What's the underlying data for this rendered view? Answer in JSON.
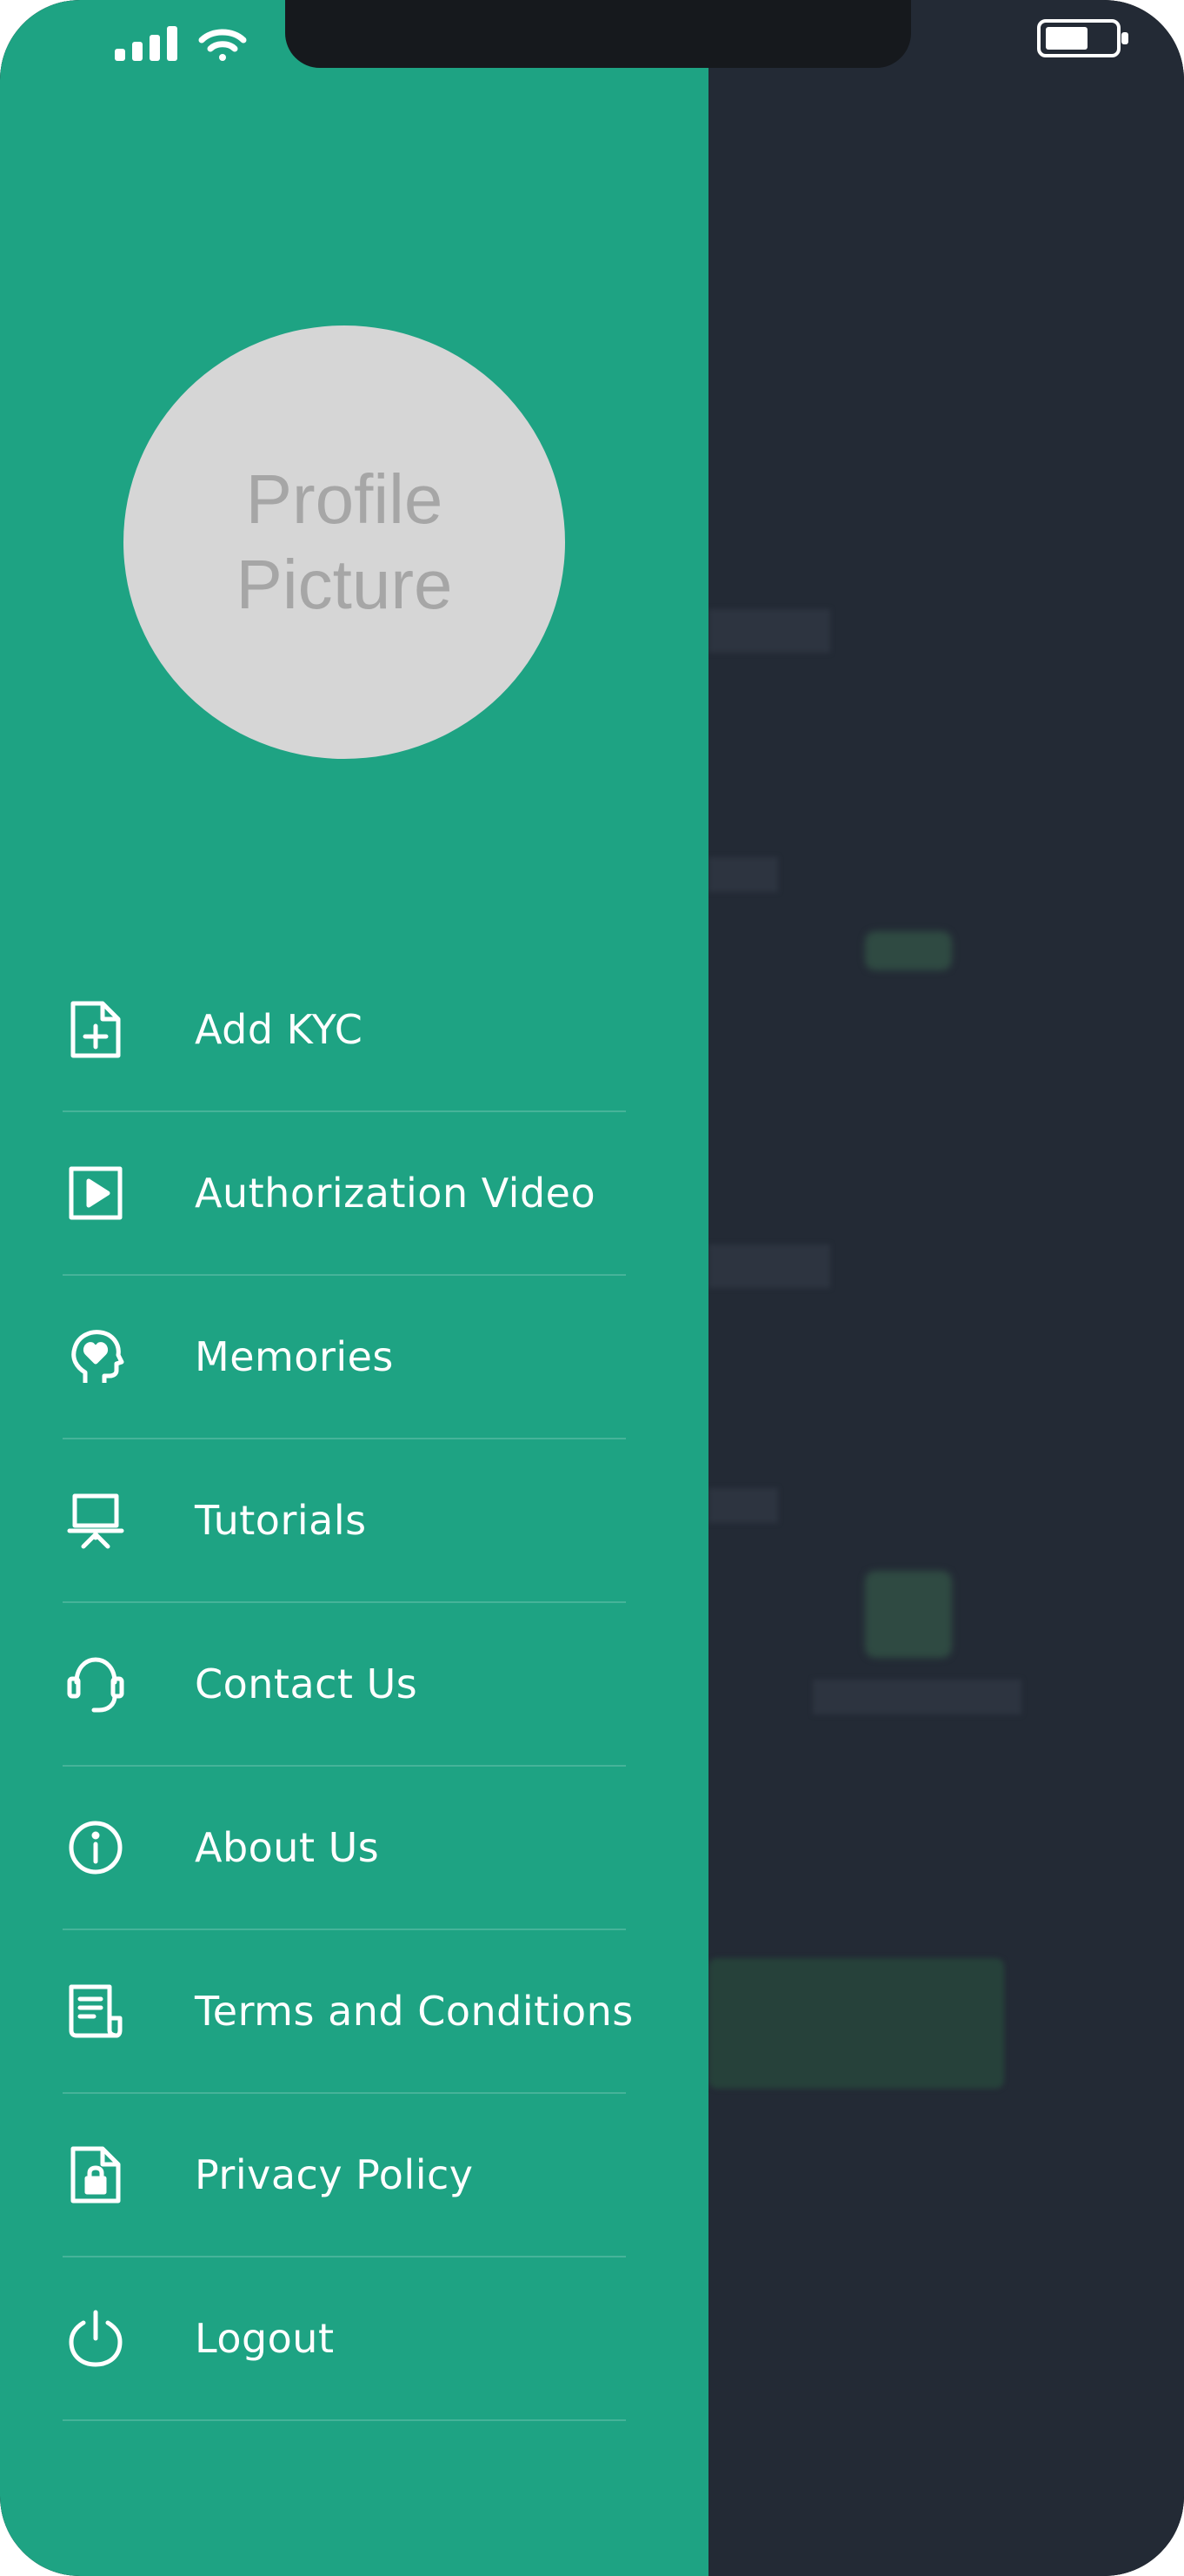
{
  "profile": {
    "placeholder": "Profile\nPicture"
  },
  "menu": [
    {
      "label": "Add KYC",
      "icon": "add-document-icon"
    },
    {
      "label": "Authorization Video",
      "icon": "play-video-icon"
    },
    {
      "label": "Memories",
      "icon": "head-heart-icon"
    },
    {
      "label": "Tutorials",
      "icon": "presentation-board-icon"
    },
    {
      "label": "Contact Us",
      "icon": "headset-icon"
    },
    {
      "label": "About Us",
      "icon": "info-icon"
    },
    {
      "label": "Terms and Conditions",
      "icon": "document-list-icon"
    },
    {
      "label": "Privacy Policy",
      "icon": "lock-document-icon"
    },
    {
      "label": "Logout",
      "icon": "power-icon"
    }
  ],
  "colors": {
    "drawer": "#1ea383",
    "background": "#232a35",
    "avatar": "#d6d6d6"
  }
}
